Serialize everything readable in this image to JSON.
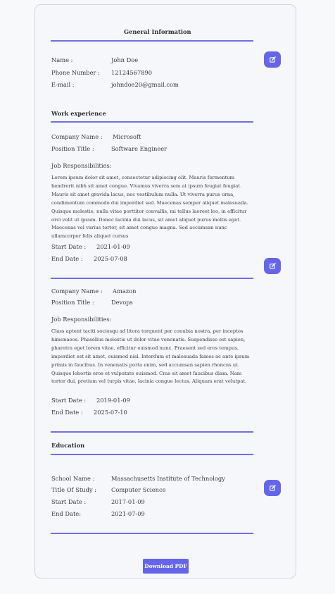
{
  "general": {
    "title": "General Information",
    "name_label": "Name :",
    "name_value": "John Doe",
    "phone_label": "Phone Number :",
    "phone_value": "12124567890",
    "email_label": "E-mail :",
    "email_value": "johndoe20@gmail.com"
  },
  "work": {
    "title": "Work experience",
    "jobs": [
      {
        "company_label": "Company Name :",
        "company": "Microsoft",
        "position_label": "Position Title :",
        "position": "Software Engineer",
        "resp_label": "Job Responsibilities:",
        "resp": "Lorem ipsum dolor sit amet, consectetur adipiscing elit. Mauris fermentum hendrerit nibh sit amet congue. Vivamus viverra sem at ipsum feugiat feugiat. Mauris sit amet gravida lacus, nec vestibulum nulla. Ut viverra purus urna, condimentum commodo dui imperdiet sed. Maecenas semper aliquet malesuada. Quisque molestie, nulla vitae porttitor convallis, mi tellus laoreet leo, in efficitur orci velit ut ipsum. Donec lacinia dui lacus, sit amet aliquet purus mollis eget. Maecenas vel varius tortor, sit amet congue magna. Sed accumsan nunc ullamcorper felis aliquet cursus",
        "start_label": "Start Date :",
        "start": "2021-01-09",
        "end_label": "End Date :",
        "end": "2025-07-08"
      },
      {
        "company_label": "Company Name :",
        "company": "Amazon",
        "position_label": "Position Title :",
        "position": "Devops",
        "resp_label": "Job Responsibilities:",
        "resp": "Class aptent taciti sociosqu ad litora torquent per conubia nostra, per inceptos himenaeos. Phasellus molestie ut dolor vitae venenatis. Suspendisse est sapien, pharetra eget lorem vitae, efficitur euismod nunc. Praesent sed eros tempus, imperdiet est sit amet, euismod nisl. Interdum et malesuada fames ac ante ipsum primis in faucibus. In venenatis porta enim, sed accumsan sapien rhoncus ut. Quisque lobortis eros et vulputate euismod. Cras sit amet faucibus diam. Nam tortor dui, pretium vel turpis vitae, lacinia congue lectus. Aliquam erat volutpat.",
        "start_label": "Start Date :",
        "start": "2019-01-09",
        "end_label": "End Date :",
        "end": "2025-07-10"
      }
    ]
  },
  "education": {
    "title": "Education",
    "school_label": "School Name :",
    "school": "Massachusetts Institute of Technology",
    "study_label": "Title Of Study :",
    "study": "Computer Science",
    "start_label": "Start Date :",
    "start": "2017-01-09",
    "end_label": "End Date:",
    "end": "2021-07-09"
  },
  "actions": {
    "download_label": "Download PDF"
  },
  "colors": {
    "accent": "#6565ea",
    "divider": "#6f6fe8",
    "icon": "pencil-square-icon"
  }
}
